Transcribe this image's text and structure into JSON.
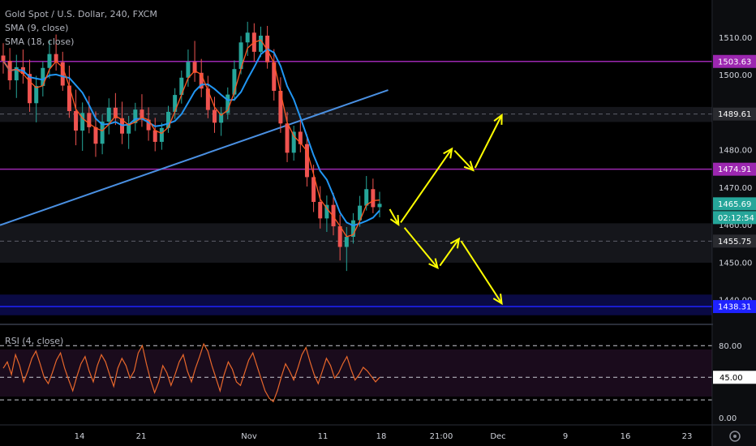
{
  "chart_data": {
    "type": "candlestick",
    "title": "Gold Spot / U.S. Dollar, 240, FXCM",
    "indicator_labels": [
      "SMA (9, close)",
      "SMA (18, close)"
    ],
    "x_ticks": [
      "14",
      "21",
      "Nov",
      "11",
      "18",
      "21:00",
      "Dec",
      "9",
      "16",
      "23"
    ],
    "price_axis": {
      "ticks": [
        "1510.00",
        "1500.00",
        "1480.00",
        "1470.00",
        "1460.00",
        "1450.00",
        "1440.00"
      ],
      "ylim": [
        1434,
        1520
      ]
    },
    "price_levels": [
      {
        "label": "1503.63",
        "value": 1503.63,
        "color": "#9c27b0"
      },
      {
        "label": "1489.61",
        "value": 1489.61,
        "color": "#5d606b"
      },
      {
        "label": "1474.91",
        "value": 1474.91,
        "color": "#9c27b0"
      },
      {
        "label": "1455.75",
        "value": 1455.75,
        "color": "#5d606b"
      },
      {
        "label": "1438.31",
        "value": 1438.31,
        "color": "#1e22ff"
      }
    ],
    "last_price": {
      "label": "1465.69",
      "value": 1465.69,
      "countdown": "02:12:54",
      "color": "#26a69a"
    },
    "trendline": {
      "from": [
        0,
        1460
      ],
      "to": [
        0.545,
        1496
      ],
      "color": "#4a90e2"
    },
    "candles_ohlc": [
      [
        1505.2,
        1508.5,
        1500.4,
        1503.8
      ],
      [
        1503.8,
        1507.2,
        1496.1,
        1498.6
      ],
      [
        1498.6,
        1505.4,
        1493.9,
        1502.1
      ],
      [
        1502.1,
        1506.8,
        1497.7,
        1500.3
      ],
      [
        1500.3,
        1504.1,
        1490.2,
        1492.5
      ],
      [
        1492.5,
        1499.8,
        1487.4,
        1497.1
      ],
      [
        1497.1,
        1503.6,
        1494.3,
        1501.9
      ],
      [
        1501.9,
        1509.3,
        1499.1,
        1505.6
      ],
      [
        1505.6,
        1510.8,
        1501.2,
        1503.4
      ],
      [
        1503.4,
        1506.2,
        1495.8,
        1497.2
      ],
      [
        1497.2,
        1502.5,
        1488.6,
        1490.4
      ],
      [
        1490.4,
        1496.1,
        1481.3,
        1485.2
      ],
      [
        1485.2,
        1492.7,
        1479.8,
        1489.9
      ],
      [
        1489.9,
        1494.4,
        1484.5,
        1486.1
      ],
      [
        1486.1,
        1490.3,
        1478.2,
        1481.7
      ],
      [
        1481.7,
        1489.5,
        1478.9,
        1487.6
      ],
      [
        1487.6,
        1493.8,
        1484.2,
        1491.3
      ],
      [
        1491.3,
        1495.2,
        1486.7,
        1488.5
      ],
      [
        1488.5,
        1492.9,
        1481.6,
        1484.4
      ],
      [
        1484.4,
        1489.1,
        1480.3,
        1487.2
      ],
      [
        1487.2,
        1492.6,
        1485.1,
        1490.8
      ],
      [
        1490.8,
        1494.9,
        1486.2,
        1488.1
      ],
      [
        1488.1,
        1491.4,
        1482.5,
        1485.3
      ],
      [
        1485.3,
        1488.6,
        1479.7,
        1482.2
      ],
      [
        1482.2,
        1487.3,
        1480.1,
        1485.9
      ],
      [
        1485.9,
        1491.8,
        1484.6,
        1490.2
      ],
      [
        1490.2,
        1496.5,
        1488.3,
        1494.7
      ],
      [
        1494.7,
        1501.2,
        1492.4,
        1499.3
      ],
      [
        1499.3,
        1506.8,
        1496.9,
        1503.5
      ],
      [
        1503.5,
        1509.1,
        1498.2,
        1500.6
      ],
      [
        1500.6,
        1504.3,
        1494.1,
        1496.4
      ],
      [
        1496.4,
        1499.8,
        1488.5,
        1490.7
      ],
      [
        1490.7,
        1494.2,
        1484.6,
        1487.3
      ],
      [
        1487.3,
        1491.5,
        1483.8,
        1489.9
      ],
      [
        1489.9,
        1496.7,
        1488.2,
        1494.8
      ],
      [
        1494.8,
        1503.9,
        1493.1,
        1501.6
      ],
      [
        1501.6,
        1510.4,
        1500.2,
        1508.7
      ],
      [
        1508.7,
        1514.2,
        1505.1,
        1511.3
      ],
      [
        1511.3,
        1513.8,
        1503.6,
        1506.2
      ],
      [
        1506.2,
        1512.9,
        1504.8,
        1510.5
      ],
      [
        1510.5,
        1513.1,
        1501.7,
        1503.4
      ],
      [
        1503.4,
        1506.9,
        1493.2,
        1495.8
      ],
      [
        1495.8,
        1499.4,
        1484.6,
        1487.1
      ],
      [
        1487.1,
        1490.2,
        1476.8,
        1479.3
      ],
      [
        1479.3,
        1486.5,
        1477.2,
        1484.9
      ],
      [
        1484.9,
        1488.7,
        1479.4,
        1481.6
      ],
      [
        1481.6,
        1484.2,
        1470.3,
        1472.8
      ],
      [
        1472.8,
        1476.1,
        1463.5,
        1466.2
      ],
      [
        1466.2,
        1470.4,
        1459.1,
        1461.8
      ],
      [
        1461.8,
        1467.9,
        1458.2,
        1465.4
      ],
      [
        1465.4,
        1468.6,
        1457.3,
        1459.7
      ],
      [
        1459.7,
        1462.8,
        1450.6,
        1454.2
      ],
      [
        1454.2,
        1459.5,
        1447.8,
        1456.9
      ],
      [
        1456.9,
        1463.2,
        1455.1,
        1461.3
      ],
      [
        1461.3,
        1467.8,
        1459.6,
        1465.2
      ],
      [
        1465.2,
        1473.1,
        1463.9,
        1469.6
      ],
      [
        1469.6,
        1472.4,
        1463.2,
        1464.8
      ],
      [
        1464.8,
        1468.9,
        1462.1,
        1465.69
      ]
    ],
    "sma_fast_label": "SMA (9, close)",
    "sma_slow_label": "SMA (18, close)",
    "projection_arrows_color": "#ffff00",
    "projection_scenarios": [
      {
        "name": "bullish",
        "path": [
          [
            1465.0,
            0.545
          ],
          [
            1460.0,
            0.56
          ],
          [
            1480.5,
            0.635
          ],
          [
            1474.5,
            0.665
          ],
          [
            1489.5,
            0.705
          ]
        ]
      },
      {
        "name": "bearish",
        "path": [
          [
            1460.0,
            0.565
          ],
          [
            1448.5,
            0.615
          ],
          [
            1456.5,
            0.645
          ],
          [
            1439.0,
            0.705
          ]
        ]
      }
    ],
    "rsi": {
      "label": "RSI (4, close)",
      "levels": [
        80,
        45,
        20
      ],
      "tick_labels": [
        "80.00",
        "45.00",
        "0.00"
      ],
      "ylim": [
        -5,
        100
      ],
      "current": "45.00",
      "values": [
        55,
        62,
        48,
        70,
        58,
        40,
        52,
        66,
        74,
        60,
        45,
        38,
        50,
        64,
        72,
        55,
        42,
        30,
        46,
        60,
        68,
        52,
        40,
        58,
        70,
        62,
        48,
        35,
        55,
        66,
        58,
        44,
        52,
        72,
        80,
        60,
        42,
        28,
        40,
        58,
        50,
        36,
        48,
        62,
        70,
        52,
        40,
        55,
        68,
        82,
        74,
        58,
        44,
        30,
        48,
        62,
        54,
        40,
        36,
        50,
        64,
        72,
        58,
        44,
        30,
        22,
        18,
        30,
        46,
        60,
        52,
        42,
        55,
        70,
        78,
        62,
        48,
        38,
        52,
        66,
        58,
        44,
        50,
        60,
        68,
        54,
        42,
        48,
        56,
        52,
        46,
        40,
        45
      ]
    },
    "grid": false,
    "legend": "top-left"
  }
}
